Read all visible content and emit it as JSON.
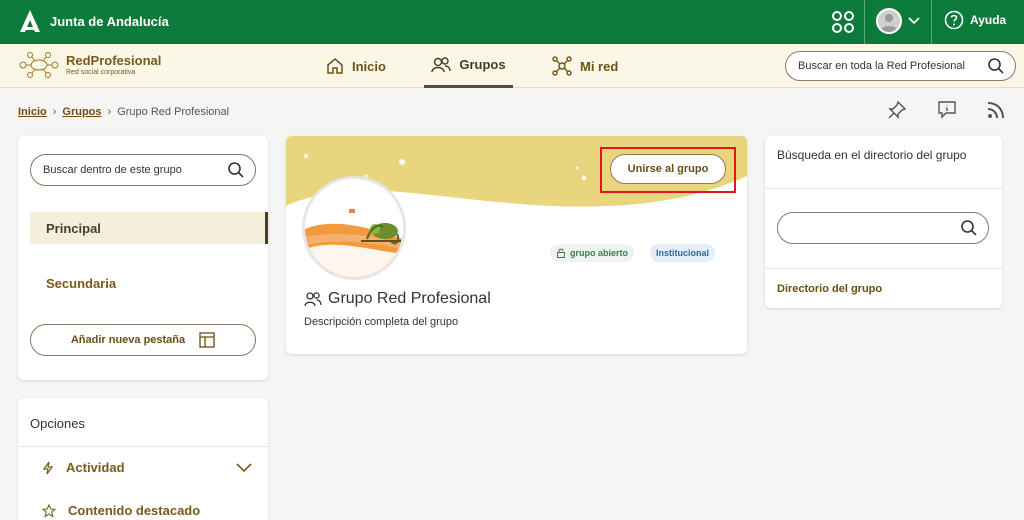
{
  "header": {
    "brand": "Junta de Andalucía",
    "help_label": "Ayuda"
  },
  "nav": {
    "logo_name": "RedProfesional",
    "logo_sub": "Red social corporativa",
    "tabs": [
      {
        "label": "Inicio"
      },
      {
        "label": "Grupos"
      },
      {
        "label": "Mi red"
      }
    ],
    "search_placeholder": "Buscar en toda la Red Profesional"
  },
  "breadcrumb": {
    "items": [
      "Inicio",
      "Grupos",
      "Grupo Red Profesional"
    ]
  },
  "left": {
    "search_placeholder": "Buscar dentro de este grupo",
    "tab_principal": "Principal",
    "tab_secundaria": "Secundaria",
    "add_tab": "Añadir nueva pestaña"
  },
  "options": {
    "title": "Opciones",
    "items": [
      "Actividad",
      "Contenido destacado"
    ]
  },
  "group": {
    "join_label": "Unirse al grupo",
    "badge_open": "grupo abierto",
    "badge_inst": "Institucional",
    "title": "Grupo Red Profesional",
    "description": "Descripción completa del grupo"
  },
  "directory": {
    "title": "Búsqueda en el directorio del grupo",
    "link": "Directorio del grupo"
  },
  "colors": {
    "header_green": "#0b7a3b",
    "accent_brown": "#6b4e14",
    "highlight_red": "#e0161e"
  }
}
